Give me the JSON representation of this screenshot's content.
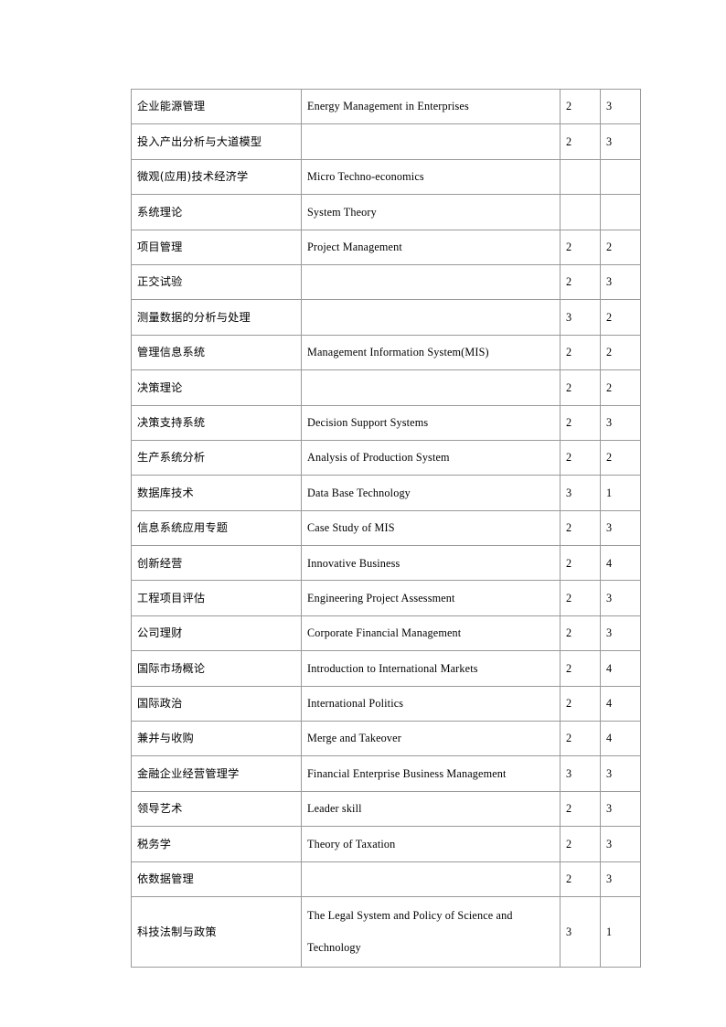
{
  "document": {
    "type": "course-catalog-table",
    "page_background": "#ffffff",
    "border_color": "#9a9a9a"
  },
  "table": {
    "name": "course-list-table",
    "columns": [
      {
        "key": "cn",
        "role": "course-name-chinese"
      },
      {
        "key": "en",
        "role": "course-name-english"
      },
      {
        "key": "credits",
        "role": "credit-hours"
      },
      {
        "key": "term",
        "role": "term"
      }
    ],
    "rows": [
      {
        "cn": "企业能源管理",
        "en": "Energy Management in Enterprises",
        "credits": "2",
        "term": "3",
        "tall": false
      },
      {
        "cn": "投入产出分析与大道模型",
        "en": "",
        "credits": "2",
        "term": "3",
        "tall": false
      },
      {
        "cn": "微观(应用)技术经济学",
        "en": "Micro Techno-economics",
        "credits": "",
        "term": "",
        "tall": false
      },
      {
        "cn": "系统理论",
        "en": "System Theory",
        "credits": "",
        "term": "",
        "tall": false
      },
      {
        "cn": "项目管理",
        "en": "Project Management",
        "credits": "2",
        "term": "2",
        "tall": false
      },
      {
        "cn": "正交试验",
        "en": "",
        "credits": "2",
        "term": "3",
        "tall": false
      },
      {
        "cn": "测量数据的分析与处理",
        "en": "",
        "credits": "3",
        "term": "2",
        "tall": false
      },
      {
        "cn": "管理信息系统",
        "en": "Management Information System(MIS)",
        "credits": "2",
        "term": "2",
        "tall": false
      },
      {
        "cn": "决策理论",
        "en": "",
        "credits": "2",
        "term": "2",
        "tall": false
      },
      {
        "cn": "决策支持系统",
        "en": "Decision Support Systems",
        "credits": "2",
        "term": "3",
        "tall": false
      },
      {
        "cn": "生产系统分析",
        "en": "Analysis of Production System",
        "credits": "2",
        "term": "2",
        "tall": false
      },
      {
        "cn": "数据库技术",
        "en": "Data Base Technology",
        "credits": "3",
        "term": "1",
        "tall": false
      },
      {
        "cn": "信息系统应用专题",
        "en": "Case Study of MIS",
        "credits": "2",
        "term": "3",
        "tall": false
      },
      {
        "cn": "创新经营",
        "en": "Innovative Business",
        "credits": "2",
        "term": "4",
        "tall": false
      },
      {
        "cn": "工程项目评估",
        "en": "Engineering Project Assessment",
        "credits": "2",
        "term": "3",
        "tall": false
      },
      {
        "cn": "公司理财",
        "en": "Corporate Financial Management",
        "credits": "2",
        "term": "3",
        "tall": false
      },
      {
        "cn": "国际市场概论",
        "en": "Introduction to International Markets",
        "credits": "2",
        "term": "4",
        "tall": false
      },
      {
        "cn": "国际政治",
        "en": "International Politics",
        "credits": "2",
        "term": "4",
        "tall": false
      },
      {
        "cn": "兼并与收购",
        "en": "Merge and Takeover",
        "credits": "2",
        "term": "4",
        "tall": false
      },
      {
        "cn": "金融企业经营管理学",
        "en": "Financial Enterprise Business Management",
        "credits": "3",
        "term": "3",
        "tall": false
      },
      {
        "cn": "领导艺术",
        "en": "Leader skill",
        "credits": "2",
        "term": "3",
        "tall": false
      },
      {
        "cn": "税务学",
        "en": "Theory of Taxation",
        "credits": "2",
        "term": "3",
        "tall": false
      },
      {
        "cn": "依数据管理",
        "en": "",
        "credits": "2",
        "term": "3",
        "tall": false
      },
      {
        "cn": "科技法制与政策",
        "en_line1": "The Legal System and Policy of Science and",
        "en_line2": "Technology",
        "en": "The Legal System and Policy of Science and Technology",
        "credits": "3",
        "term": "1",
        "tall": true
      }
    ]
  }
}
